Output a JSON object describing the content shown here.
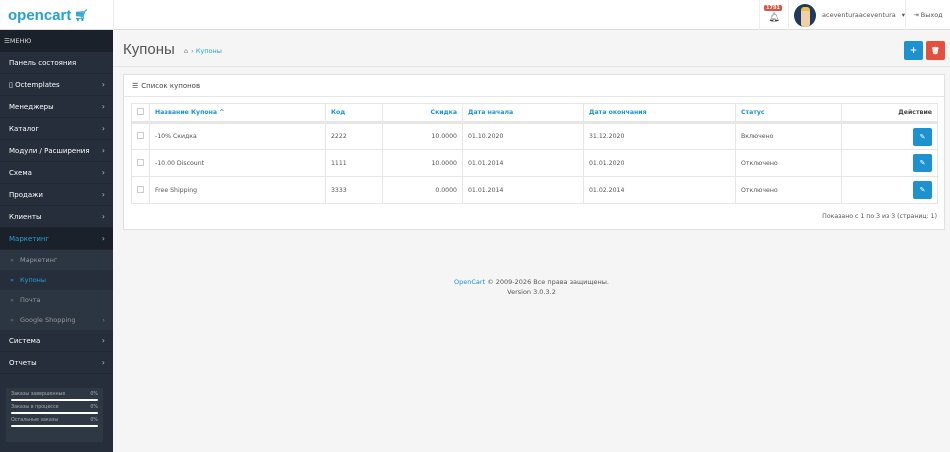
{
  "header": {
    "logo": "opencart",
    "notifications": "1791",
    "username": "aceventuraaceventura",
    "logout": "Выход"
  },
  "sidebar": {
    "menu_title": "МЕНЮ",
    "items": [
      {
        "label": "Панель состояния",
        "chev": ""
      },
      {
        "label": "▯ Octemplates",
        "chev": "›"
      },
      {
        "label": "Менеджеры",
        "chev": "›"
      },
      {
        "label": "Каталог",
        "chev": "›"
      },
      {
        "label": "Модули / Расширения",
        "chev": "›"
      },
      {
        "label": "Схема",
        "chev": "›"
      },
      {
        "label": "Продажи",
        "chev": "›"
      },
      {
        "label": "Клиенты",
        "chev": "›"
      },
      {
        "label": "Маркетинг",
        "chev": "›"
      }
    ],
    "sub": [
      {
        "label": "Маркетинг"
      },
      {
        "label": "Купоны"
      },
      {
        "label": "Почта"
      },
      {
        "label": "Google Shopping"
      }
    ],
    "items2": [
      {
        "label": "Система",
        "chev": "›"
      },
      {
        "label": "Отчеты",
        "chev": "›"
      }
    ],
    "stats": [
      {
        "label": "Заказы завершенные",
        "value": "0%",
        "percent": 0
      },
      {
        "label": "Заказы в процессе",
        "value": "0%",
        "percent": 0
      },
      {
        "label": "Остальные заказы",
        "value": "0%",
        "percent": 0
      }
    ]
  },
  "page": {
    "title": "Купоны",
    "breadcrumb": "Купоны",
    "panel_title": "Список купонов"
  },
  "table": {
    "headers": [
      "Название Купона ^",
      "Код",
      "Скидка",
      "Дата начала",
      "Дата окончания",
      "Статус",
      "Действие"
    ],
    "rows": [
      [
        "-10% Скидка",
        "2222",
        "10.0000",
        "01.10.2020",
        "31.12.2020",
        "Включено"
      ],
      [
        "-10.00 Discount",
        "1111",
        "10.0000",
        "01.01.2014",
        "01.01.2020",
        "Отключено"
      ],
      [
        "Free Shipping",
        "3333",
        "0.0000",
        "01.01.2014",
        "01.02.2014",
        "Отключено"
      ]
    ]
  },
  "pagination": "Показано с 1 по 3 из 3 (страниц: 1)",
  "footer": {
    "link": "OpenCart",
    "copyright": " © 2009-2026 Все права защищены.",
    "version": "Version 3.0.3.2"
  }
}
